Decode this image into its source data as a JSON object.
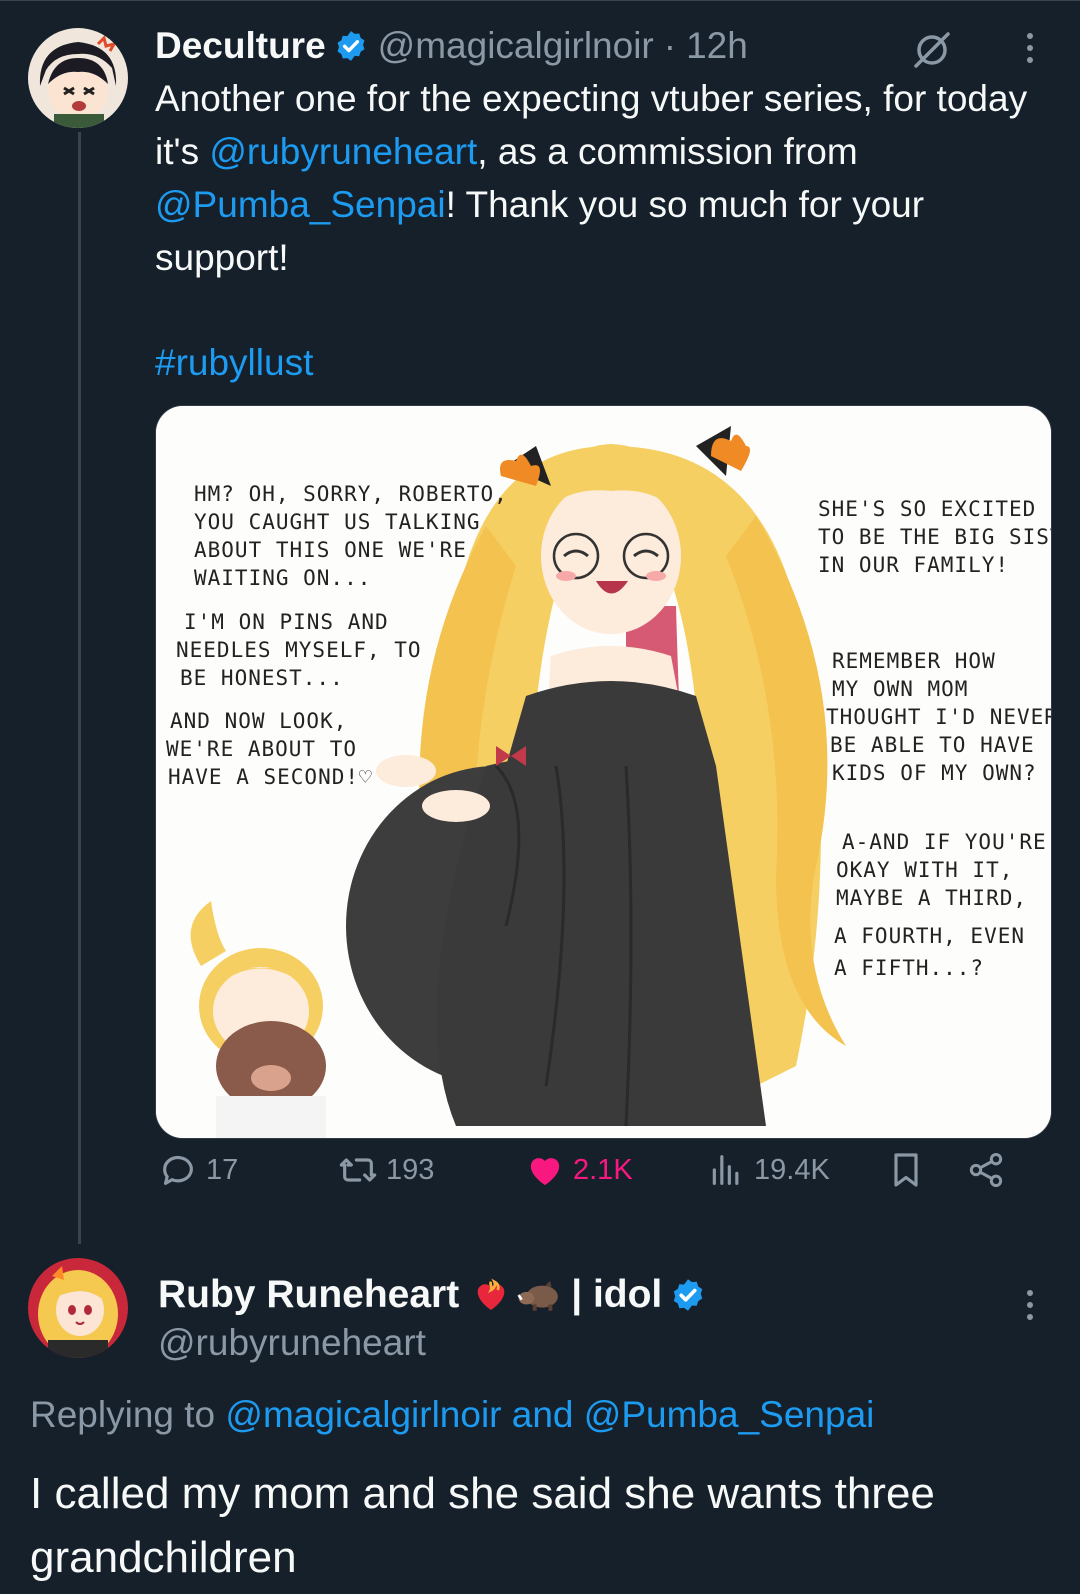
{
  "tweet": {
    "display_name": "Deculture",
    "handle": "@magicalgirlnoir",
    "separator": "·",
    "time": "12h",
    "text_before_mention1": "Another one for the expecting vtuber series, for today it's ",
    "mention1": "@rubyruneheart",
    "text_between_mentions": ", as a commission from ",
    "mention2": "@Pumba_Senpai",
    "text_after_mention2": "! Thank you so much for your support!",
    "hashtag": "#rubyllust",
    "image": {
      "speech_left": [
        [
          "HM? OH, SORRY, ROBERTO,",
          "YOU CAUGHT US TALKING",
          "ABOUT THIS ONE WE'RE",
          "WAITING ON..."
        ],
        [
          "I'M ON PINS AND",
          "NEEDLES MYSELF, TO",
          "BE HONEST..."
        ],
        [
          "AND NOW LOOK,",
          "WE'RE ABOUT TO",
          "HAVE A SECOND!♡"
        ]
      ],
      "speech_right": [
        [
          "SHE'S SO EXCITED",
          "TO BE THE BIG SISTER",
          "IN OUR FAMILY!"
        ],
        [
          "REMEMBER HOW",
          "MY OWN MOM",
          "THOUGHT I'D NEVER",
          "BE ABLE TO HAVE",
          "KIDS OF MY OWN?"
        ],
        [
          "A-AND IF YOU'RE",
          "OKAY WITH IT,",
          "MAYBE A THIRD,",
          "A FOURTH, EVEN",
          "A FIFTH...?"
        ]
      ]
    },
    "actions": {
      "replies": "17",
      "retweets": "193",
      "likes": "2.1K",
      "views": "19.4K"
    },
    "icons": [
      "verified-badge-icon",
      "grok-slash-icon",
      "more-icon",
      "reply-icon",
      "retweet-icon",
      "heart-icon",
      "views-icon",
      "bookmark-icon",
      "share-icon"
    ]
  },
  "reply": {
    "display_name": "Ruby Runeheart",
    "name_emoji": [
      "heart-on-fire-icon",
      "boar-icon"
    ],
    "name_suffix": "| idol",
    "handle": "@rubyruneheart",
    "replying_label": "Replying to ",
    "replying_mention1": "@magicalgirlnoir",
    "replying_and": " and ",
    "replying_mention2": "@Pumba_Senpai",
    "text": "I called my mom and she said she wants three grandchildren"
  },
  "colors": {
    "background": "#15202b",
    "link": "#1d9bf0",
    "muted": "#8b98a5",
    "like": "#f91880",
    "verified": "#1d9bf0"
  }
}
